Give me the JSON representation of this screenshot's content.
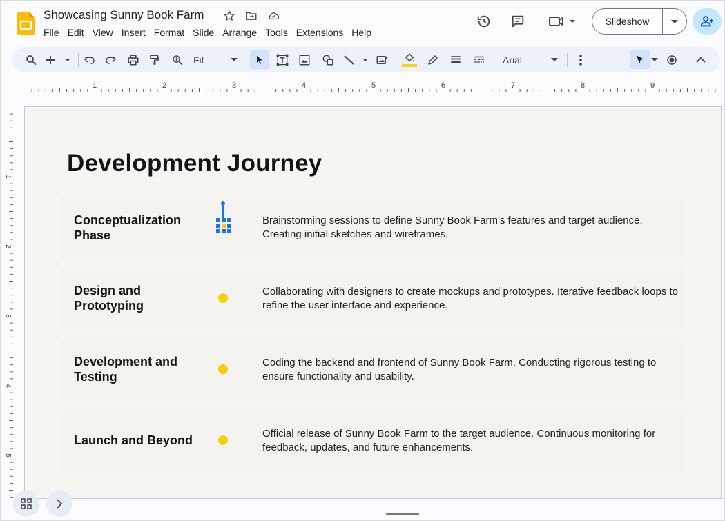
{
  "header": {
    "title": "Showcasing Sunny Book Farm",
    "menu": [
      "File",
      "Edit",
      "View",
      "Insert",
      "Format",
      "Slide",
      "Arrange",
      "Tools",
      "Extensions",
      "Help"
    ],
    "slideshow_label": "Slideshow",
    "icons": [
      "star-icon",
      "move-folder-icon",
      "cloud-saved-icon",
      "history-icon",
      "comments-icon",
      "meet-icon",
      "add-person-icon"
    ]
  },
  "toolbar": {
    "zoom_label": "Fit",
    "font_label": "Arial",
    "fill_accent": "#fbd21a"
  },
  "ruler": {
    "h_labels": [
      "1",
      "2",
      "3",
      "4",
      "5",
      "6",
      "7",
      "8",
      "9"
    ],
    "v_labels": [
      "1",
      "2",
      "3",
      "4",
      "5"
    ]
  },
  "slide": {
    "title": "Development Journey",
    "rows": [
      {
        "title": "Conceptualization Phase",
        "desc": "Brainstorming sessions to define Sunny Book Farm's features and target audience. Creating initial sketches and wireframes."
      },
      {
        "title": "Design and Prototyping",
        "desc": "Collaborating with designers to create mockups and prototypes. Iterative feedback loops to refine the user interface and experience."
      },
      {
        "title": "Development and Testing",
        "desc": "Coding the backend and frontend of Sunny Book Farm. Conducting rigorous testing to ensure functionality and usability."
      },
      {
        "title": "Launch and Beyond",
        "desc": "Official release of Sunny Book Farm to the target audience. Continuous monitoring for feedback, updates, and future enhancements."
      }
    ],
    "dot_color": "#f5cf0a",
    "selection_color": "#1a73e8"
  }
}
